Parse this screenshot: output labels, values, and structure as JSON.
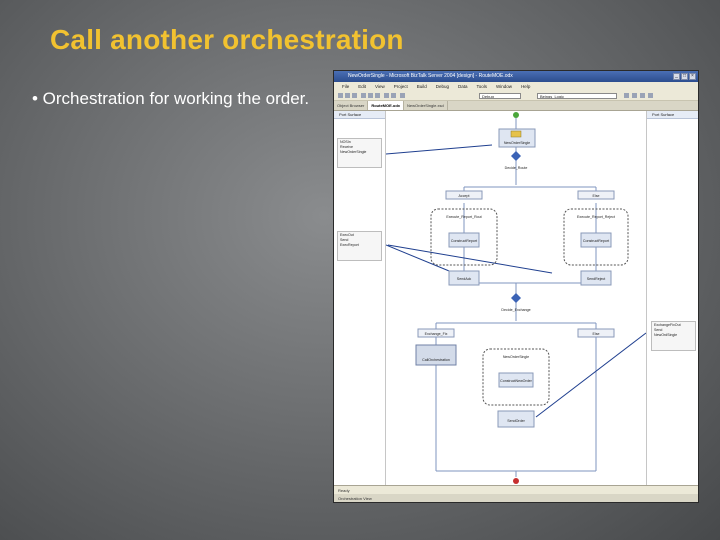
{
  "slide": {
    "title": "Call another orchestration",
    "bullet": "• Orchestration for working the order."
  },
  "window": {
    "title": "NewOrderSingle - Microsoft BizTalk Server 2004 [design] - RouteMOE.odx",
    "buttons": [
      "_",
      "□",
      "×"
    ]
  },
  "menu": [
    "File",
    "Edit",
    "View",
    "Project",
    "Build",
    "Debug",
    "Data",
    "Tools",
    "Window",
    "Help"
  ],
  "toolbar": {
    "config_combo": "Debug",
    "search_combo": "Beings_Logic"
  },
  "tabs": [
    {
      "label": "Object Browser",
      "active": false
    },
    {
      "label": "RouteMOE.odx",
      "active": true
    },
    {
      "label": "NewOrderSingle.xsd",
      "active": false
    }
  ],
  "left_lane": {
    "header": "Port Surface",
    "ports": [
      {
        "name": "NOSIn",
        "role": "Receive",
        "op": "NewOrderSingle"
      },
      {
        "name": "ExecOut",
        "role": "Send",
        "op": "ExecReport"
      }
    ]
  },
  "right_lane": {
    "header": "Port Surface",
    "ports": [
      {
        "name": "ExchangeFixOut",
        "role": "Send",
        "op": "NewOrdSingle"
      }
    ]
  },
  "shapes": {
    "receive": "NewOrderSingle",
    "decide": "Decide_Route",
    "branch_accept": "Accept",
    "branch_else": "Else",
    "scope_left": "Execute_Report_Rout",
    "scope_right": "Execute_Report_Reject",
    "construct_left": "ConstructReport",
    "construct_right": "ConstructReport",
    "send_left": "SendAck",
    "send_right": "SendReject",
    "decide2": "Decide_Exchange",
    "branch2_left": "Exchange_Fix",
    "branch2_right": "Else",
    "call": "CallOrchestration",
    "scope_new": "NewOrderSingle",
    "construct_new": "ConstructNewOrder",
    "send_order": "SendOrder"
  },
  "status": {
    "left": "Ready",
    "bottom": "Orchestration View"
  },
  "colors": {
    "title": "#f2c230",
    "port_line": "#1f3f8f",
    "flow_line": "#7f94bf",
    "start": "#4aa63a",
    "end": "#c62f2f",
    "send_icon": "#e6c24a"
  }
}
